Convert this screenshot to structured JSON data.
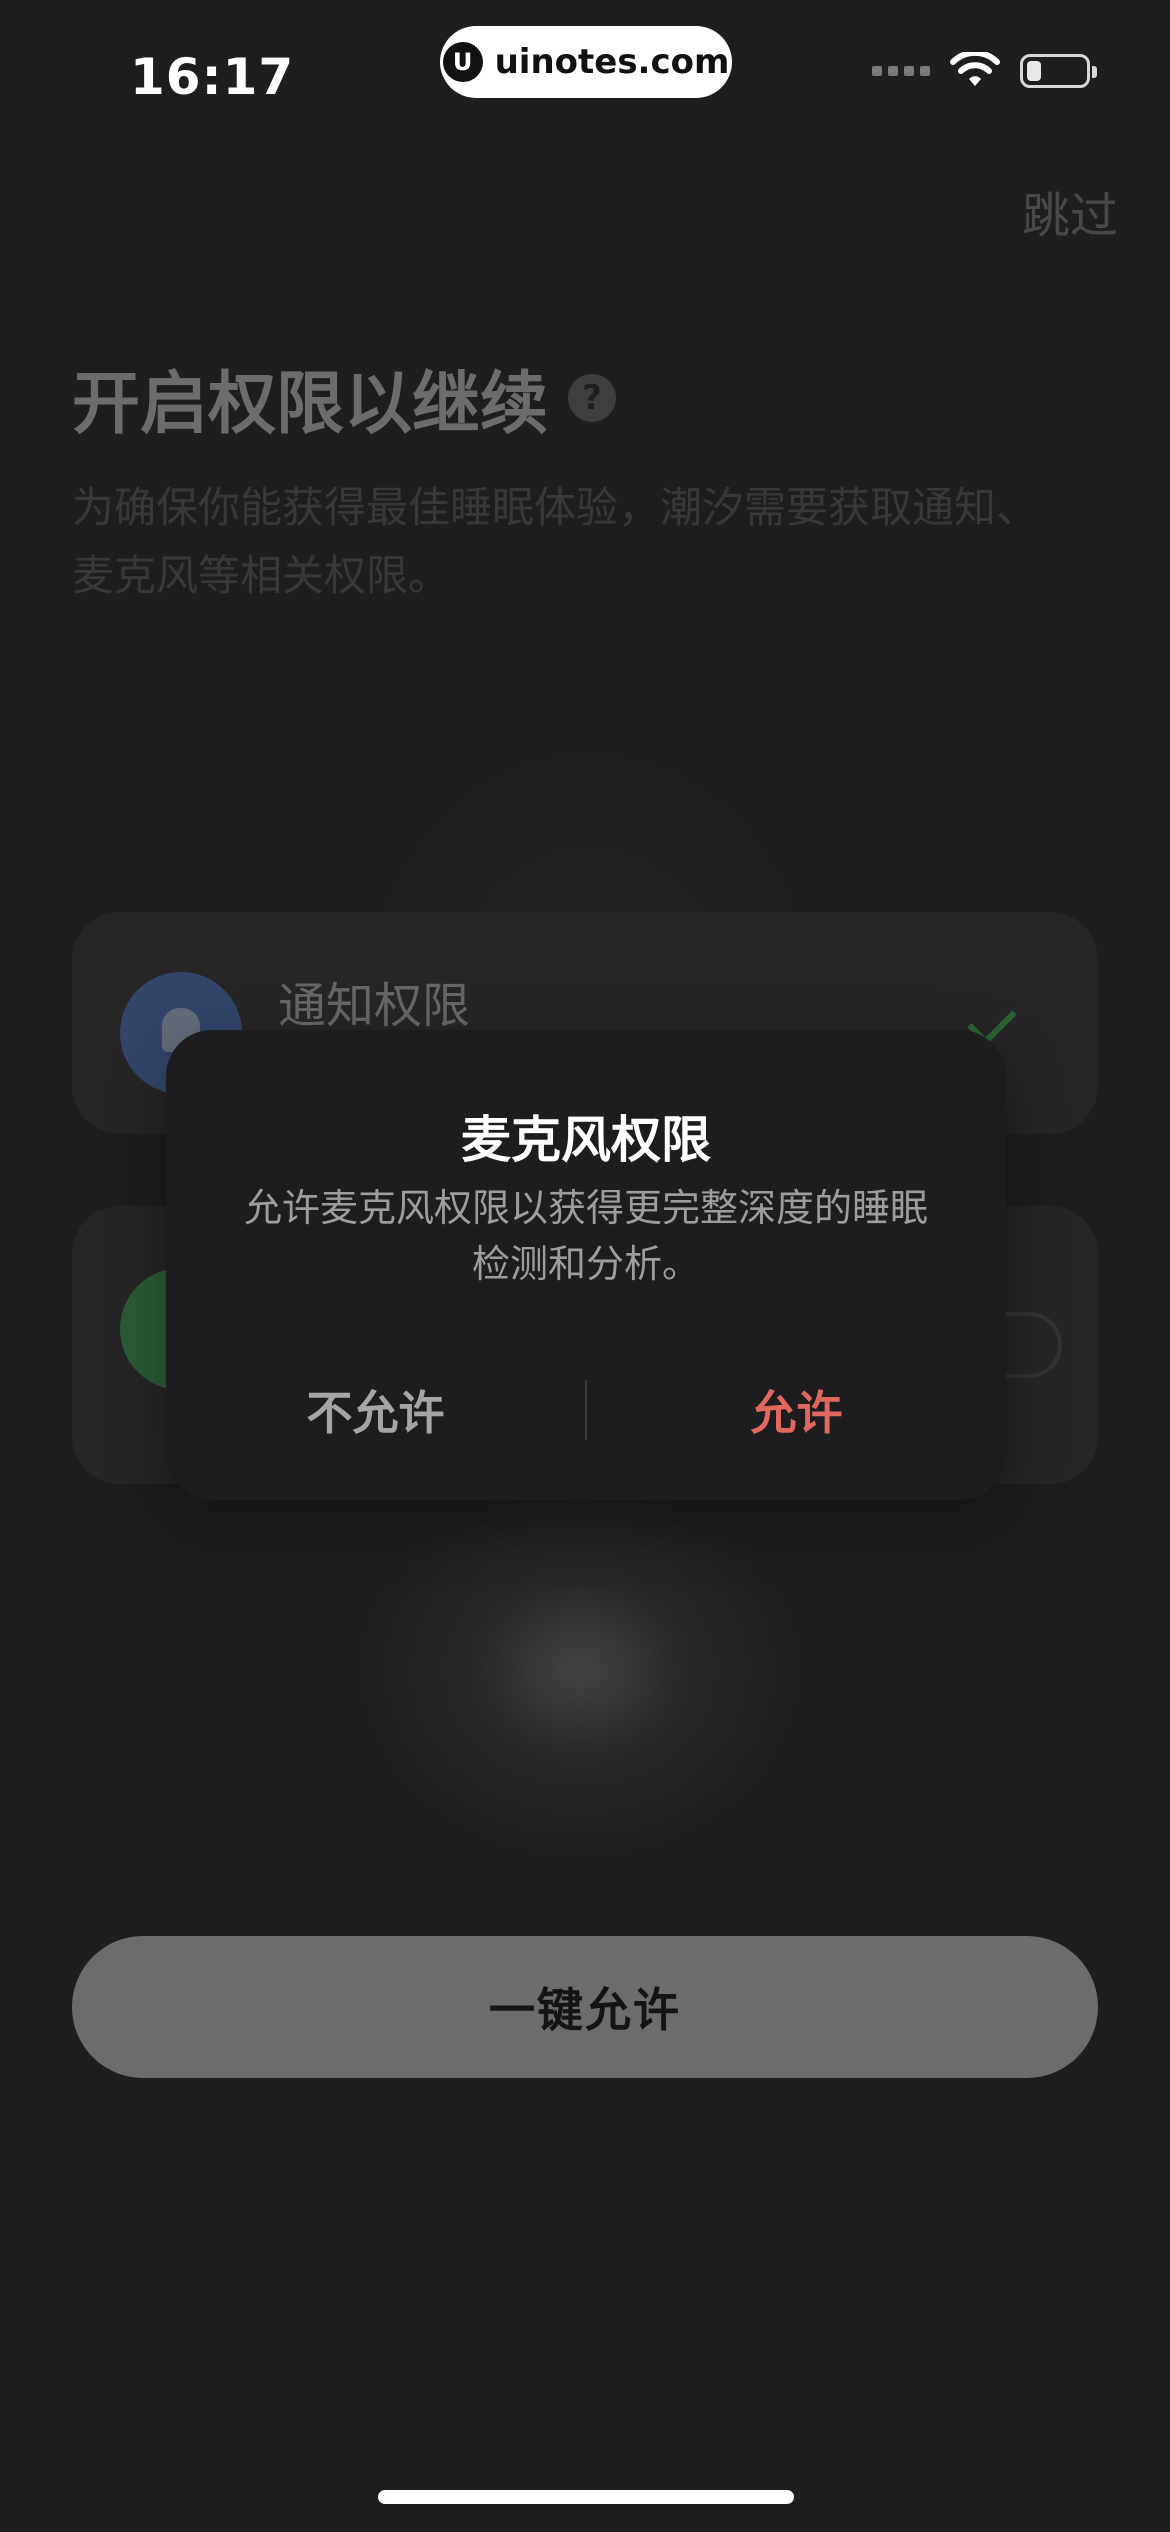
{
  "status_bar": {
    "time": "16:17",
    "url": "uinotes.com",
    "logo": "U"
  },
  "header": {
    "skip_label": "跳过",
    "title": "开启权限以继续",
    "help_icon_glyph": "?",
    "subtitle": "为确保你能获得最佳睡眠体验，潮汐需要获取通知、麦克风等相关权限。"
  },
  "permissions": [
    {
      "label": "通知权限",
      "icon": "bell-icon",
      "status": "granted"
    },
    {
      "label": "",
      "icon": "microphone-icon",
      "status": "pending"
    }
  ],
  "primary_button": {
    "label": "一键允许"
  },
  "dialog": {
    "title": "麦克风权限",
    "message": "允许麦克风权限以获得更完整深度的睡眠检测和分析。",
    "deny_label": "不允许",
    "allow_label": "允许"
  },
  "colors": {
    "background": "#2a2a2a",
    "allow": "#e1685f",
    "check": "#3e9a4d",
    "button": "#a9a9a9"
  }
}
